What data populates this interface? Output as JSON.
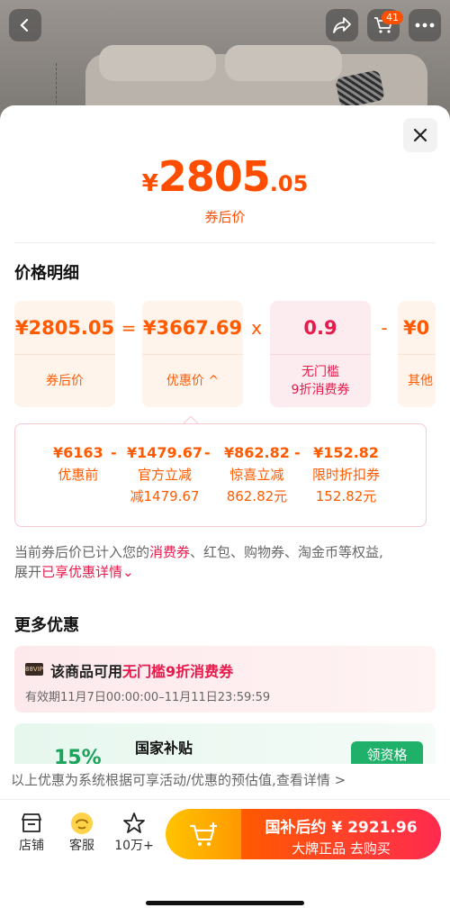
{
  "header": {
    "back_icon": "chevron-left-icon",
    "share_icon": "share-icon",
    "cart_icon": "cart-icon",
    "cart_badge": "41",
    "more_icon": "more-icon"
  },
  "sheet": {
    "close_icon": "close-icon",
    "price": {
      "yen": "¥",
      "int": "2805",
      "dec": ".05",
      "label": "券后价"
    },
    "detail_title": "价格明细",
    "calc": [
      {
        "value": "¥2805.05",
        "label": "券后价",
        "style": "orange"
      },
      {
        "op": "="
      },
      {
        "value": "¥3667.69",
        "label": "优惠价 ^",
        "style": "orange"
      },
      {
        "op": "x"
      },
      {
        "value": "0.9",
        "label": "无门槛\n9折消费券",
        "style": "pink"
      },
      {
        "op": "-"
      },
      {
        "value": "¥0",
        "label": "其他",
        "style": "orange"
      }
    ],
    "breakdown": [
      {
        "a": "¥6163",
        "b": "优惠前",
        "c": ""
      },
      {
        "a": "¥1479.67",
        "b": "官方立减",
        "c": "减1479.67"
      },
      {
        "a": "¥862.82",
        "b": "惊喜立减",
        "c": "862.82元"
      },
      {
        "a": "¥152.82",
        "b": "限时折扣券",
        "c": "152.82元"
      }
    ],
    "breakdown_op": "-",
    "note_1": "当前券后价已计入您的",
    "note_hl1": "消费券",
    "note_2": "、红包、购物券、淘金币等权益,",
    "note_3": "展开",
    "note_hl2": "已享优惠详情",
    "note_chevron": "⌄",
    "more_title": "更多优惠",
    "coupon": {
      "vip": "88VIP",
      "title_1": "该商品可用",
      "title_hl": "无门槛9折消费券",
      "validity": "有效期11月7日00:00:00–11月11日23:59:59"
    },
    "subsidy": {
      "pct": "15%",
      "title": "国家补贴",
      "button": "领资格"
    },
    "disclaimer": "以上优惠为系统根据可享活动/优惠的预估值,查看详情 >"
  },
  "bottom": {
    "store_label": "店铺",
    "service_label": "客服",
    "fav_label": "10万+",
    "buy_line1": "国补后约 ¥ 2921.96",
    "buy_line2": "大牌正品  去购买"
  },
  "colors": {
    "accent": "#ff4d00",
    "pink": "#e8194b",
    "green": "#1fb16a"
  }
}
